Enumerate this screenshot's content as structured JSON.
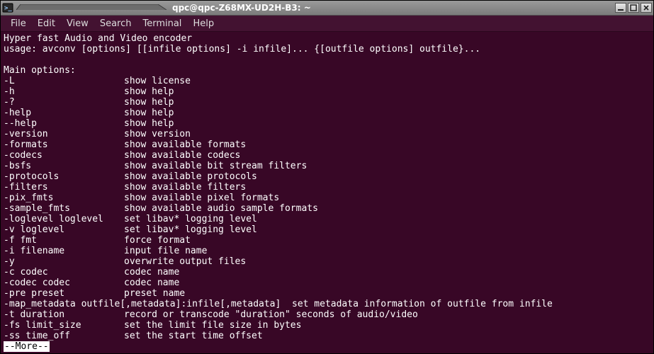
{
  "window": {
    "title": "qpc@qpc-Z68MX-UD2H-B3: ~"
  },
  "menu": {
    "items": [
      "File",
      "Edit",
      "View",
      "Search",
      "Terminal",
      "Help"
    ]
  },
  "terminal": {
    "header_line1": "Hyper fast Audio and Video encoder",
    "header_line2": "usage: avconv [options] [[infile options] -i infile]... {[outfile options] outfile}...",
    "section": "Main options:",
    "options": [
      {
        "flag": "-L",
        "desc": "show license"
      },
      {
        "flag": "-h",
        "desc": "show help"
      },
      {
        "flag": "-?",
        "desc": "show help"
      },
      {
        "flag": "-help",
        "desc": "show help"
      },
      {
        "flag": "--help",
        "desc": "show help"
      },
      {
        "flag": "-version",
        "desc": "show version"
      },
      {
        "flag": "-formats",
        "desc": "show available formats"
      },
      {
        "flag": "-codecs",
        "desc": "show available codecs"
      },
      {
        "flag": "-bsfs",
        "desc": "show available bit stream filters"
      },
      {
        "flag": "-protocols",
        "desc": "show available protocols"
      },
      {
        "flag": "-filters",
        "desc": "show available filters"
      },
      {
        "flag": "-pix_fmts",
        "desc": "show available pixel formats"
      },
      {
        "flag": "-sample_fmts",
        "desc": "show available audio sample formats"
      },
      {
        "flag": "-loglevel loglevel",
        "desc": "set libav* logging level"
      },
      {
        "flag": "-v loglevel",
        "desc": "set libav* logging level"
      },
      {
        "flag": "-f fmt",
        "desc": "force format"
      },
      {
        "flag": "-i filename",
        "desc": "input file name"
      },
      {
        "flag": "-y",
        "desc": "overwrite output files"
      },
      {
        "flag": "-c codec",
        "desc": "codec name"
      },
      {
        "flag": "-codec codec",
        "desc": "codec name"
      },
      {
        "flag": "-pre preset",
        "desc": "preset name"
      }
    ],
    "wrap1": "-map_metadata outfile[,metadata]:infile[,metadata]  set metadata information of outfile from infile",
    "opts2": [
      {
        "flag": "-t duration",
        "desc": "record or transcode \"duration\" seconds of audio/video"
      },
      {
        "flag": "-fs limit_size",
        "desc": "set the limit file size in bytes"
      },
      {
        "flag": "-ss time_off",
        "desc": "set the start time offset"
      }
    ],
    "more": "--More--"
  }
}
